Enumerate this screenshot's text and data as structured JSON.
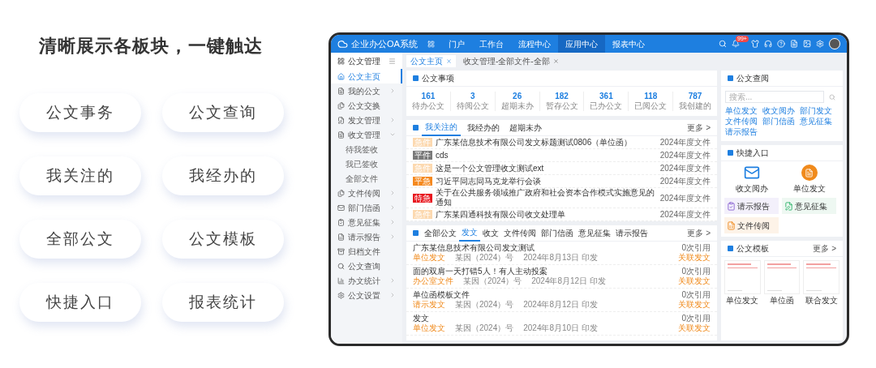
{
  "promo": {
    "title": "清晰展示各板块，一键触达",
    "features": [
      "公文事务",
      "公文查询",
      "我关注的",
      "我经办的",
      "全部公文",
      "公文模板",
      "快捷入口",
      "报表统计"
    ]
  },
  "app": {
    "brand": "企业办公OA系统",
    "nav": [
      {
        "label": "门户",
        "selected": false
      },
      {
        "label": "工作台",
        "selected": false
      },
      {
        "label": "流程中心",
        "selected": false
      },
      {
        "label": "应用中心",
        "selected": true
      },
      {
        "label": "报表中心",
        "selected": false
      }
    ],
    "notification_badge": "99+",
    "sidebar": {
      "title": "公文管理",
      "items": [
        {
          "kind": "link",
          "label": "公文主页",
          "selected": true
        },
        {
          "kind": "group",
          "label": "我的公文",
          "selected": false,
          "expanded": false
        },
        {
          "kind": "link",
          "label": "公文交换",
          "selected": false
        },
        {
          "kind": "group",
          "label": "发文管理",
          "selected": false,
          "expanded": false
        },
        {
          "kind": "group",
          "label": "收文管理",
          "selected": false,
          "expanded": true,
          "children": [
            {
              "label": "待我签收",
              "selected": false
            },
            {
              "label": "我已签收",
              "selected": false
            },
            {
              "label": "全部文件",
              "selected": false
            }
          ]
        },
        {
          "kind": "group",
          "label": "文件传阅",
          "selected": false,
          "expanded": false
        },
        {
          "kind": "group",
          "label": "部门信函",
          "selected": false,
          "expanded": false
        },
        {
          "kind": "group",
          "label": "意见征集",
          "selected": false,
          "expanded": false
        },
        {
          "kind": "group",
          "label": "请示报告",
          "selected": false,
          "expanded": false
        },
        {
          "kind": "link",
          "label": "归档文件",
          "selected": false
        },
        {
          "kind": "link",
          "label": "公文查询",
          "selected": false
        },
        {
          "kind": "group",
          "label": "办文统计",
          "selected": false,
          "expanded": false
        },
        {
          "kind": "group",
          "label": "公文设置",
          "selected": false,
          "expanded": false
        }
      ]
    },
    "tabs": [
      {
        "label": "公文主页",
        "selected": true
      },
      {
        "label": "收文管理-全部文件-全部",
        "selected": false
      }
    ],
    "affairs": {
      "title": "公文事项",
      "stats": [
        {
          "value": "161",
          "label": "待办公文"
        },
        {
          "value": "3",
          "label": "待阅公文"
        },
        {
          "value": "26",
          "label": "超期未办"
        },
        {
          "value": "182",
          "label": "暂存公文"
        },
        {
          "value": "361",
          "label": "已办公文"
        },
        {
          "value": "118",
          "label": "已阅公文"
        },
        {
          "value": "787",
          "label": "我创建的"
        }
      ]
    },
    "focus": {
      "tabs": [
        {
          "label": "我关注的",
          "selected": true
        },
        {
          "label": "我经办的",
          "selected": false
        },
        {
          "label": "超期未办",
          "selected": false
        }
      ],
      "more": "更多 >",
      "rows": [
        {
          "badge": "急件",
          "color": "#fcd9b0",
          "title": "广东某信息技术有限公司发文标题测试0806（单位函）",
          "date": "2024年度文件"
        },
        {
          "badge": "平件",
          "color": "#7a7a7a",
          "title": "cds",
          "date": "2024年度文件"
        },
        {
          "badge": "急件",
          "color": "#fcd9b0",
          "title": "这是一个公文管理收文测试ext",
          "date": "2024年度文件"
        },
        {
          "badge": "平急",
          "color": "#f5891f",
          "title": "习近平同志同马克龙举行会谈",
          "date": "2024年度文件"
        },
        {
          "badge": "特急",
          "color": "#e8171f",
          "title": "关于在公共服务领域推广政府和社会资本合作模式实施意见的通知",
          "date": "2024年度文件"
        },
        {
          "badge": "急件",
          "color": "#fcd9b0",
          "title": "广东某四通科技有限公司收文处理单",
          "date": "2024年度文件"
        }
      ]
    },
    "documents": {
      "tabs": [
        {
          "label": "全部公文",
          "selected": false
        },
        {
          "label": "发文",
          "selected": true
        },
        {
          "label": "收文",
          "selected": false
        },
        {
          "label": "文件传阅",
          "selected": false
        },
        {
          "label": "部门信函",
          "selected": false
        },
        {
          "label": "意见征集",
          "selected": false
        },
        {
          "label": "请示报告",
          "selected": false
        }
      ],
      "more": "更多 >",
      "rows": [
        {
          "title": "广东某信息技术有限公司发文测试",
          "type": "单位发文",
          "number": "某因（2024）号",
          "date": "2024年8月13日 印发",
          "citations": "0次引用",
          "link": "关联发文"
        },
        {
          "title": "面的双肩一天打错5人！有人主动投案",
          "type": "办公室文件",
          "number": "某因（2024）号",
          "date": "2024年8月12日 印发",
          "citations": "0次引用",
          "link": "关联发文"
        },
        {
          "title": "单位函模板文件",
          "type": "请示发文",
          "number": "某因（2024）号",
          "date": "2024年8月12日 印发",
          "citations": "0次引用",
          "link": "关联发文"
        },
        {
          "title": "发文",
          "type": "单位发文",
          "number": "某因（2024）号",
          "date": "2024年8月10日 印发",
          "citations": "0次引用",
          "link": "关联发文"
        }
      ]
    },
    "lookup": {
      "title": "公文查阅",
      "placeholder": "搜索...",
      "links": [
        "单位发文",
        "收文阅办",
        "部门发文",
        "文件传阅",
        "部门信函",
        "意见征集",
        "请示报告"
      ]
    },
    "shortcuts": {
      "title": "快捷入口",
      "items": [
        {
          "kind": "large",
          "label": "收文阅办"
        },
        {
          "kind": "large",
          "label": "单位发文"
        },
        {
          "kind": "tile",
          "label": "请示报告"
        },
        {
          "kind": "tile",
          "label": "意见征集"
        },
        {
          "kind": "tile",
          "label": "文件传阅"
        }
      ]
    },
    "templates": {
      "title": "公文模板",
      "more": "更多 >",
      "items": [
        {
          "label": "单位发文"
        },
        {
          "label": "单位函"
        },
        {
          "label": "联合发文"
        }
      ]
    }
  }
}
